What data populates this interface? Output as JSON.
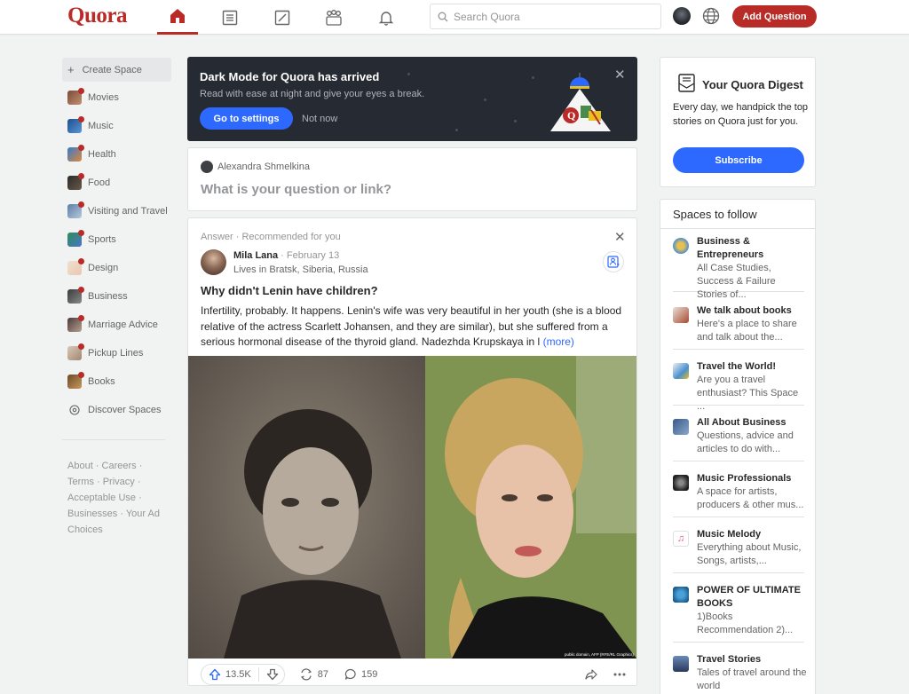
{
  "header": {
    "logo": "Quora",
    "search_placeholder": "Search Quora",
    "add_question": "Add Question",
    "colors": {
      "brand": "#b92b27",
      "accent": "#2e69ff"
    },
    "nav_icons": [
      "home-icon",
      "answer-list-icon",
      "edit-icon",
      "spaces-icon",
      "bell-icon"
    ]
  },
  "sidebar": {
    "create_space": "Create Space",
    "items": [
      {
        "label": "Movies"
      },
      {
        "label": "Music"
      },
      {
        "label": "Health"
      },
      {
        "label": "Food"
      },
      {
        "label": "Visiting and Travel"
      },
      {
        "label": "Sports"
      },
      {
        "label": "Design"
      },
      {
        "label": "Business"
      },
      {
        "label": "Marriage Advice"
      },
      {
        "label": "Pickup Lines"
      },
      {
        "label": "Books"
      }
    ],
    "discover": "Discover Spaces",
    "footer": "About · Careers · Terms · Privacy · Acceptable Use · Businesses · Your Ad Choices"
  },
  "dark_mode_banner": {
    "title": "Dark Mode for Quora has arrived",
    "subtitle": "Read with ease at night and give your eyes a break.",
    "primary_button": "Go to settings",
    "secondary_button": "Not now"
  },
  "ask_box": {
    "user": "Alexandra Shmelkina",
    "prompt": "What is your question or link?"
  },
  "post": {
    "meta": "Answer · Recommended for you",
    "author": "Mila Lana",
    "date": " · February 13",
    "location": "Lives in Bratsk, Siberia, Russia",
    "question": "Why didn't Lenin have children?",
    "body": "Infertility, probably. It happens. Lenin's wife was very beautiful in her youth (she is a blood relative of the actress Scarlett Johansen, and they are similar), but she suffered from a serious hormonal disease of the thyroid gland. Nadezhda Krupskaya in l",
    "more": "(more)",
    "photo_credit": "public domain, AFP (RFE/RL Graphics)",
    "upvotes": "13.5K",
    "shares": "87",
    "comments": "159"
  },
  "digest": {
    "title": "Your Quora Digest",
    "text": "Every day, we handpick the top stories on Quora just for you.",
    "button": "Subscribe"
  },
  "spaces_to_follow": {
    "heading": "Spaces to follow",
    "items": [
      {
        "name": "Business & Entrepreneurs",
        "desc": "All Case Studies, Success & Failure Stories of..."
      },
      {
        "name": "We talk about books",
        "desc": "Here's a place to share and talk about the..."
      },
      {
        "name": "Travel the World!",
        "desc": "Are you a travel enthusiast? This Space ..."
      },
      {
        "name": "All About Business",
        "desc": "Questions, advice and articles to do with..."
      },
      {
        "name": "Music Professionals",
        "desc": "A space for artists, producers & other mus..."
      },
      {
        "name": "Music Melody",
        "desc": "Everything about Music, Songs, artists,..."
      },
      {
        "name": "POWER OF ULTIMATE BOOKS",
        "desc": "1)Books Recommendation 2)..."
      },
      {
        "name": "Travel Stories",
        "desc": "Tales of travel around the world"
      }
    ]
  }
}
